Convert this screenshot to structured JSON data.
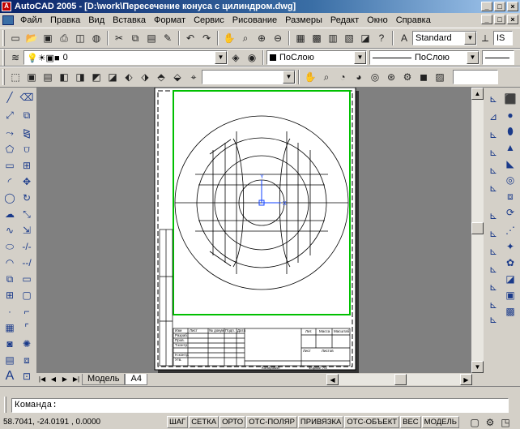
{
  "window": {
    "title": "AutoCAD 2005 - [D:\\work\\Пересечение конуса с цилиндром.dwg]",
    "app_icon": "A"
  },
  "window_buttons": [
    "_",
    "□",
    "×"
  ],
  "menu": [
    "Файл",
    "Правка",
    "Вид",
    "Вставка",
    "Формат",
    "Сервис",
    "Рисование",
    "Размеры",
    "Редакт",
    "Окно",
    "Справка"
  ],
  "toolbar1": {
    "text_style": "Standard",
    "dim_style": "IS"
  },
  "toolbar2": {
    "layer": "0",
    "color": "ПоСлою",
    "linetype": "ПоСлою"
  },
  "tabs": {
    "model": "Модель",
    "layout": "A4"
  },
  "command": {
    "prompt": "Команда:"
  },
  "status": {
    "coords": "58.7041,  -24.0191 , 0.0000",
    "modes": [
      "ШАГ",
      "СЕТКА",
      "ОРТО",
      "ОТС-ПОЛЯР",
      "ПРИВЯЗКА",
      "ОТС-ОБЪЕКТ",
      "ВЕС",
      "МОДЕЛЬ"
    ]
  },
  "drawing": {
    "ucs_y": "Y",
    "ucs_x": "X",
    "title_block": {
      "row_labels": [
        "Изм",
        "Лист",
        "№ докум.",
        "Подп.",
        "Дата"
      ],
      "rows": [
        "Разраб.",
        "Пров.",
        "Т.контр.",
        "Н.контр.",
        "Утв."
      ],
      "cols": [
        "Лит.",
        "Масса",
        "Масштаб"
      ],
      "sheet": "Лист",
      "sheets": "Листов",
      "copied": "Копировал",
      "format": "Формат   А4"
    }
  },
  "colors": {
    "accent": "#0a246a",
    "viewport_border": "#00c000",
    "canvas": "#808080"
  }
}
